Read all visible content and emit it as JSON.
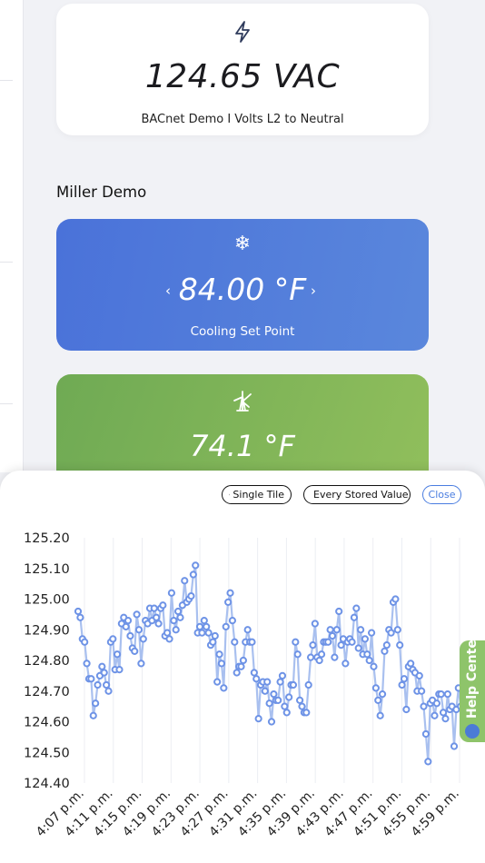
{
  "voltage_card": {
    "value": "124.65 VAC",
    "label": "BACnet Demo I Volts L2 to Neutral",
    "icon": "bolt-icon"
  },
  "section": {
    "title": "Miller Demo"
  },
  "cooling_card": {
    "value": "84.00 °F",
    "label": "Cooling Set Point",
    "prev": "‹",
    "next": "›",
    "icon": "snowflake-icon",
    "color": "#4a72d9"
  },
  "temp_card": {
    "value": "74.1 °F",
    "icon": "tower-icon",
    "color": "#7db35a"
  },
  "sheet": {
    "buttons": {
      "single_tile": "Single Tile",
      "every_stored": "Every Stored Value",
      "close": "Close"
    }
  },
  "help": {
    "label": "Help Center"
  },
  "chart_data": {
    "type": "line",
    "ylim": [
      124.4,
      125.2
    ],
    "yticks": [
      "125.20",
      "125.10",
      "125.00",
      "124.90",
      "124.80",
      "124.70",
      "124.60",
      "124.50",
      "124.40"
    ],
    "xticks": [
      "4:07 p.m.",
      "4:11 p.m.",
      "4:15 p.m.",
      "4:19 p.m.",
      "4:23 p.m.",
      "4:27 p.m.",
      "4:31 p.m.",
      "4:35 p.m.",
      "4:39 p.m.",
      "4:43 p.m.",
      "4:47 p.m.",
      "4:51 p.m.",
      "4:55 p.m.",
      "4:59 p.m."
    ],
    "grid": true,
    "series": [
      {
        "color": "#6e93e6",
        "values": [
          124.96,
          124.94,
          124.87,
          124.86,
          124.79,
          124.74,
          124.74,
          124.62,
          124.66,
          124.72,
          124.75,
          124.78,
          124.76,
          124.72,
          124.7,
          124.86,
          124.87,
          124.77,
          124.82,
          124.77,
          124.92,
          124.94,
          124.91,
          124.93,
          124.88,
          124.84,
          124.83,
          124.95,
          124.9,
          124.79,
          124.87,
          124.93,
          124.92,
          124.97,
          124.93,
          124.97,
          124.94,
          124.92,
          124.97,
          124.98,
          124.88,
          124.89,
          124.87,
          125.02,
          124.93,
          124.9,
          124.96,
          124.94,
          124.98,
          125.06,
          124.99,
          125.0,
          125.01,
          125.08,
          125.11,
          124.89,
          124.91,
          124.89,
          124.93,
          124.91,
          124.89,
          124.85,
          124.86,
          124.88,
          124.73,
          124.82,
          124.79,
          124.71,
          124.91,
          124.99,
          125.02,
          124.93,
          124.86,
          124.76,
          124.78,
          124.78,
          124.8,
          124.86,
          124.9,
          124.86,
          124.86,
          124.76,
          124.74,
          124.61,
          124.72,
          124.73,
          124.7,
          124.73,
          124.66,
          124.6,
          124.69,
          124.67,
          124.67,
          124.73,
          124.75,
          124.65,
          124.63,
          124.68,
          124.72,
          124.72,
          124.86,
          124.82,
          124.67,
          124.65,
          124.63,
          124.63,
          124.72,
          124.81,
          124.85,
          124.92,
          124.81,
          124.8,
          124.82,
          124.86,
          124.86,
          124.86,
          124.9,
          124.88,
          124.81,
          124.9,
          124.96,
          124.85,
          124.87,
          124.79,
          124.86,
          124.87,
          124.86,
          124.94,
          124.97,
          124.84,
          124.9,
          124.82,
          124.87,
          124.82,
          124.8,
          124.89,
          124.78,
          124.71,
          124.67,
          124.62,
          124.69,
          124.83,
          124.85,
          124.9,
          124.89,
          124.99,
          125.0,
          124.9,
          124.85,
          124.72,
          124.74,
          124.64,
          124.78,
          124.79,
          124.77,
          124.76,
          124.7,
          124.75,
          124.7,
          124.65,
          124.56,
          124.47,
          124.66,
          124.67,
          124.62,
          124.66,
          124.69,
          124.69,
          124.63,
          124.61,
          124.69,
          124.64,
          124.65,
          124.52,
          124.64,
          124.71,
          124.65,
          124.7,
          124.68
        ]
      }
    ]
  }
}
